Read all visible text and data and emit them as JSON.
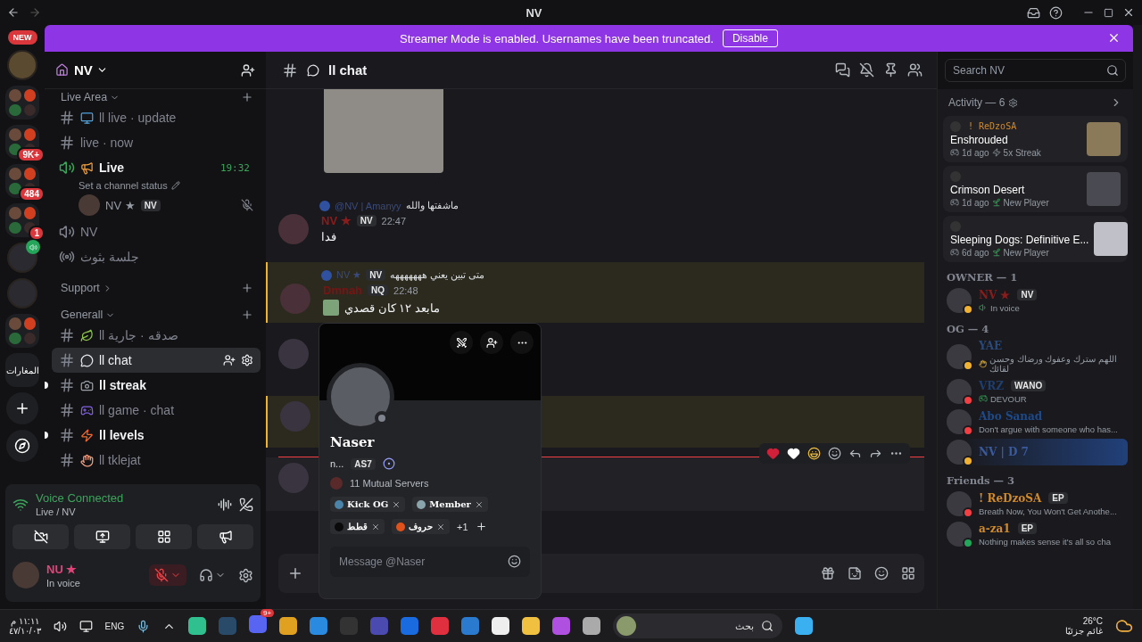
{
  "window": {
    "title": "NV"
  },
  "banner": {
    "message": "Streamer Mode is enabled. Usernames have been truncated.",
    "button": "Disable"
  },
  "servers": [
    {
      "kind": "new",
      "label": "NEW"
    },
    {
      "kind": "server"
    },
    {
      "kind": "folder"
    },
    {
      "kind": "folder",
      "badge": "9K+"
    },
    {
      "kind": "folder",
      "badge": "484"
    },
    {
      "kind": "folder",
      "badge": "1"
    },
    {
      "kind": "server",
      "voice": true
    },
    {
      "kind": "server"
    },
    {
      "kind": "folder"
    },
    {
      "kind": "label",
      "label": "المغارات"
    },
    {
      "kind": "add"
    },
    {
      "kind": "discover"
    }
  ],
  "server": {
    "name": "NV"
  },
  "channels": [
    {
      "kind": "category",
      "name": "Live Area",
      "expanded": true
    },
    {
      "kind": "text",
      "name": "ll live · update",
      "emoji": {
        "kind": "monitor"
      },
      "unread": false,
      "selected": false
    },
    {
      "kind": "text",
      "name": "live · now",
      "unread": false,
      "selected": false
    },
    {
      "kind": "voice",
      "name": "Live",
      "emoji": {
        "kind": "megaphone"
      },
      "connected": true,
      "timer": "19:32",
      "status": "Set a channel status",
      "members": [
        {
          "name": "NV ★",
          "tag": "NV"
        }
      ]
    },
    {
      "kind": "voice",
      "name": "NV",
      "connected": false
    },
    {
      "kind": "stage",
      "name": "جلسة بثوث"
    },
    {
      "kind": "category",
      "name": "Support",
      "expanded": false
    },
    {
      "kind": "category",
      "name": "Generall",
      "expanded": true
    },
    {
      "kind": "text",
      "name": "ll صدقه · جارية",
      "emoji": {
        "kind": "leaf"
      },
      "unread": false,
      "selected": false
    },
    {
      "kind": "text",
      "name": "ll chat",
      "emoji": {
        "kind": "speech"
      },
      "unread": false,
      "selected": true
    },
    {
      "kind": "text",
      "name": "ll streak",
      "emoji": {
        "kind": "camera"
      },
      "unread": true,
      "selected": false
    },
    {
      "kind": "text",
      "name": "ll game · chat",
      "emoji": {
        "kind": "gamepad"
      },
      "unread": false,
      "selected": false
    },
    {
      "kind": "text",
      "name": "ll levels",
      "emoji": {
        "kind": "bolt"
      },
      "unread": true,
      "selected": false
    },
    {
      "kind": "text",
      "name": "ll tklejat",
      "emoji": {
        "kind": "hand"
      },
      "unread": false,
      "selected": false
    }
  ],
  "voice_panel": {
    "title": "Voice Connected",
    "location": "Live / NV"
  },
  "user": {
    "name": "NU ★",
    "status": "In voice",
    "mic_muted": true
  },
  "chat": {
    "channel": "ll chat",
    "messages": [
      {
        "kind": "image"
      },
      {
        "kind": "message",
        "highlighted": false,
        "reply": {
          "author": "@NV | Amanyy",
          "text": "ماشفتها والله"
        },
        "author": "NV ★",
        "color": "#8a1c1c",
        "tag": "NV",
        "time": "22:47",
        "text": "فدا",
        "sticker": false
      },
      {
        "kind": "message",
        "highlighted": true,
        "reply": {
          "author": "NV ★",
          "tag": "NV",
          "text": "متى تبين يعني هههههههه"
        },
        "author": "Dmnah",
        "color": "#7a1414",
        "tag": "NQ",
        "time": "22:48",
        "text": "مابعد ١٢ كان قصدي",
        "sticker": true
      },
      {
        "kind": "covered",
        "highlighted": false,
        "hovered": false
      },
      {
        "kind": "covered",
        "highlighted": true,
        "hovered": false
      },
      {
        "kind": "divider"
      },
      {
        "kind": "covered",
        "highlighted": false,
        "hovered": true
      }
    ]
  },
  "profile": {
    "name": "Naser",
    "username": "n...",
    "tag": "AS7",
    "mutual": "11 Mutual Servers",
    "roles": [
      {
        "name": "Kick OG",
        "color": "#4a84a8"
      },
      {
        "name": "Member",
        "color": "#8aa4ac"
      },
      {
        "name": "قطط",
        "color": "#0a0a0a"
      },
      {
        "name": "حروف",
        "color": "#e0521c"
      }
    ],
    "more_roles": "+1",
    "placeholder": "Message @Naser"
  },
  "search": {
    "placeholder": "Search NV"
  },
  "activity": {
    "title": "Activity — 6",
    "cards": [
      {
        "user": "! ReDzoSA",
        "game": "Enshrouded",
        "time": "1d ago",
        "badge": {
          "kind": "streak",
          "label": "5x Streak"
        }
      },
      {
        "game": "Crimson Desert",
        "time": "1d ago",
        "badge": {
          "kind": "new",
          "label": "New Player"
        }
      },
      {
        "game": "Sleeping Dogs: Definitive E...",
        "time": "6d ago",
        "badge": {
          "kind": "new",
          "label": "New Player"
        }
      }
    ]
  },
  "member_groups": [
    {
      "title": "OWNER — 1",
      "members": [
        {
          "name": "NV ★",
          "color": "#8a1c1c",
          "tag": "NV",
          "status": {
            "kind": "voice",
            "text": "In voice"
          },
          "presence": {
            "kind": "idle"
          },
          "banner": false
        }
      ]
    },
    {
      "title": "OG — 4",
      "members": [
        {
          "name": "YAE",
          "color": "#2a4a7a",
          "status": {
            "kind": "emoji",
            "text": "اللهم سترك وعفوك ورضاك وحسن لقائك"
          },
          "presence": {
            "kind": "idle"
          },
          "banner": false
        },
        {
          "name": "VRZ",
          "color": "#1e3e6e",
          "tag": "WANO",
          "status": {
            "kind": "game",
            "text": "DEVOUR"
          },
          "presence": {
            "kind": "dnd"
          },
          "banner": false
        },
        {
          "name": "Abo Sanad",
          "color": "#1e4a8a",
          "status": {
            "kind": "text",
            "text": "Don't argue with someone who has..."
          },
          "presence": {
            "kind": "dnd"
          },
          "banner": false
        },
        {
          "name": "NV | D 7",
          "color": "#3a5a9e",
          "presence": {
            "kind": "idle"
          },
          "banner": true
        }
      ]
    },
    {
      "title": "Friends — 3",
      "members": [
        {
          "name": "! ReDzoSA",
          "color": "#d08a2a",
          "tag": "EP",
          "status": {
            "kind": "text",
            "text": "Breath Now, You Won't Get Anothe..."
          },
          "presence": {
            "kind": "dnd"
          },
          "banner": false
        },
        {
          "name": "a-za1",
          "color": "#d08a2a",
          "tag": "EP",
          "status": {
            "kind": "text",
            "text": "Nothing makes sense it's all so cha"
          },
          "presence": {
            "kind": "online"
          },
          "banner": false
        }
      ]
    }
  ],
  "taskbar": {
    "time": "١١:١١ م",
    "date": "٤٧/١٠/٠٣",
    "language": "ENG",
    "app_badge": "9+",
    "search": {
      "placeholder": "بحث"
    },
    "temperature": "26°C",
    "weather": "غائم جزئيًا"
  }
}
